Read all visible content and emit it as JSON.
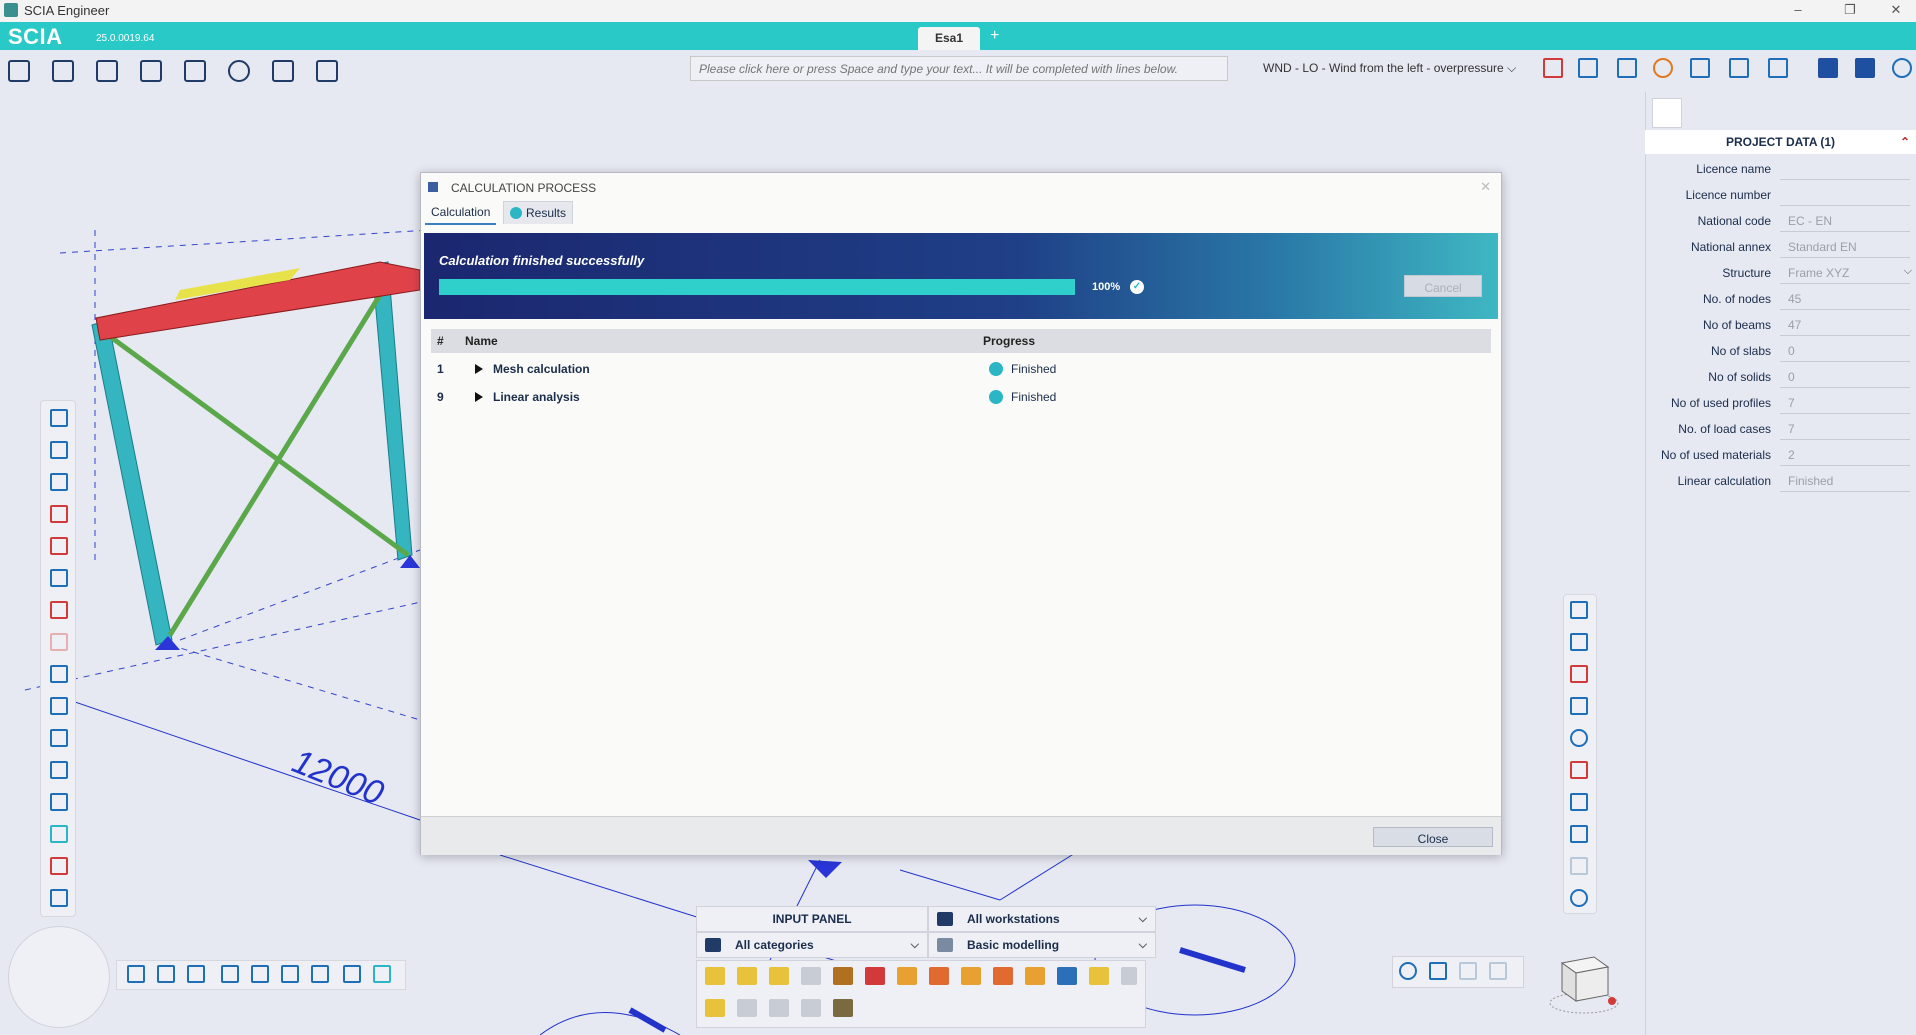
{
  "window": {
    "title": "SCIA Engineer",
    "minimize_icon": "minimize-icon",
    "restore_icon": "restore-icon",
    "close_icon": "close-icon"
  },
  "header": {
    "logo": "SCIA",
    "version": "25.0.0019.64",
    "document_tab": "Esa1",
    "add_tab": "+"
  },
  "toolbar": {
    "command_placeholder": "Please click here or press Space and type your text... It will be completed with lines below.",
    "load_case": "WND - LO - Wind from the left  - overpressure"
  },
  "dialog": {
    "title": "CALCULATION PROCESS",
    "tabs": [
      "Calculation",
      "Results"
    ],
    "status": "Calculation finished successfully",
    "progress": 1.0,
    "progress_label": "100%",
    "cancel_label": "Cancel",
    "close_label": "Close",
    "columns": [
      "#",
      "Name",
      "Progress"
    ],
    "rows": [
      {
        "num": "1",
        "name": "Mesh calculation",
        "progress": "Finished"
      },
      {
        "num": "9",
        "name": "Linear analysis",
        "progress": "Finished"
      }
    ]
  },
  "project_data": {
    "title": "PROJECT DATA (1)",
    "fields": [
      {
        "label": "Licence name",
        "value": ""
      },
      {
        "label": "Licence number",
        "value": ""
      },
      {
        "label": "National code",
        "value": "EC - EN"
      },
      {
        "label": "National annex",
        "value": "Standard EN"
      },
      {
        "label": "Structure",
        "value": "Frame XYZ"
      },
      {
        "label": "No. of nodes",
        "value": "45"
      },
      {
        "label": "No of beams",
        "value": "47"
      },
      {
        "label": "No of slabs",
        "value": "0"
      },
      {
        "label": "No of solids",
        "value": "0"
      },
      {
        "label": "No of used profiles",
        "value": "7"
      },
      {
        "label": "No. of load cases",
        "value": "7"
      },
      {
        "label": "No of used materials",
        "value": "2"
      },
      {
        "label": "Linear calculation",
        "value": "Finished"
      }
    ]
  },
  "viewport": {
    "dimension_label": "12000"
  },
  "input_panel": {
    "title": "INPUT PANEL",
    "category": "All categories",
    "workstation": "All workstations",
    "modelling": "Basic modelling"
  },
  "colors": {
    "accent": "#28c9c6",
    "banner_dark": "#1b2770",
    "success": "#2bb6c6",
    "beam_red": "#e0424a",
    "column_teal": "#35b5c0",
    "brace_green": "#5aa84a"
  }
}
